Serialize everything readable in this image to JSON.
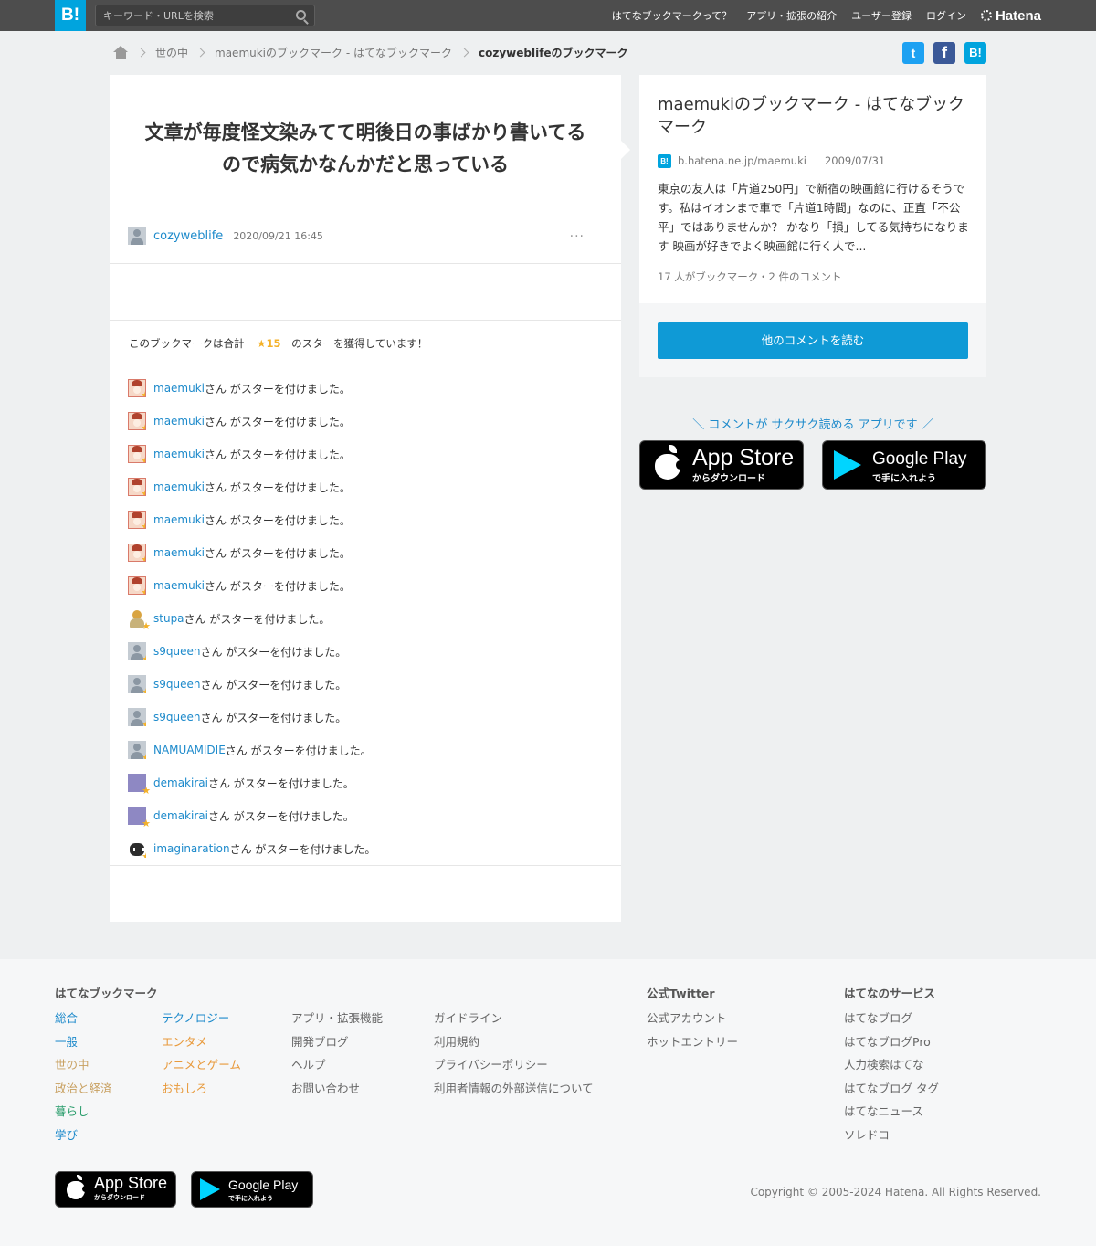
{
  "header": {
    "logo": "B!",
    "search_placeholder": "キーワード・URLを検索",
    "nav": [
      "はてなブックマークって？",
      "アプリ・拡張の紹介",
      "ユーザー登録",
      "ログイン"
    ],
    "brand": "Hatena"
  },
  "breadcrumb": {
    "items": [
      "世の中",
      "maemukiのブックマーク - はてなブックマーク"
    ],
    "current": "cozyweblifeのブックマーク"
  },
  "share": {
    "twitter": "t",
    "facebook": "f",
    "hatena": "B!"
  },
  "comment": {
    "text": "文章が毎度怪文染みてて明後日の事ばかり書いてるので病気かなんかだと思っている",
    "user": "cozyweblife",
    "date": "2020/09/21 16:45",
    "more": "···"
  },
  "stars": {
    "summary_prefix": "このブックマークは合計",
    "count": "★15",
    "summary_suffix": "のスターを獲得しています！",
    "suffix": "さん がスターを付けました。",
    "star_glyph": "★",
    "list": [
      {
        "user": "maemuki",
        "avatar": "maemuki"
      },
      {
        "user": "maemuki",
        "avatar": "maemuki"
      },
      {
        "user": "maemuki",
        "avatar": "maemuki"
      },
      {
        "user": "maemuki",
        "avatar": "maemuki"
      },
      {
        "user": "maemuki",
        "avatar": "maemuki"
      },
      {
        "user": "maemuki",
        "avatar": "maemuki"
      },
      {
        "user": "maemuki",
        "avatar": "maemuki"
      },
      {
        "user": "stupa",
        "avatar": "stupa"
      },
      {
        "user": "s9queen",
        "avatar": "default"
      },
      {
        "user": "s9queen",
        "avatar": "default"
      },
      {
        "user": "s9queen",
        "avatar": "default"
      },
      {
        "user": "NAMUAMIDIE",
        "avatar": "default"
      },
      {
        "user": "demakirai",
        "avatar": "demakirai"
      },
      {
        "user": "demakirai",
        "avatar": "demakirai"
      },
      {
        "user": "imaginaration",
        "avatar": "imagination"
      }
    ]
  },
  "entry": {
    "title": "maemukiのブックマーク - はてなブックマーク",
    "favicon": "B!",
    "domain": "b.hatena.ne.jp/maemuki",
    "date": "2009/07/31",
    "description": "東京の友人は「片道250円」で新宿の映画館に行けるそうです。私はイオンまで車で「片道1時間」なのに、正直「不公平」ではありませんか？ かなり「損」してる気持ちになります 映画が好きでよく映画館に行く人で...",
    "count_text": "17 人がブックマーク・2 件のコメント",
    "read_more": "他のコメントを読む"
  },
  "app_promo": "＼ コメントが サクサク読める アプリです ／",
  "stores": {
    "app_store": {
      "title": "App Store",
      "sub": "からダウンロード"
    },
    "google_play": {
      "title": "Google Play",
      "sub": "で手に入れよう"
    }
  },
  "footer": {
    "col1_title": "はてなブックマーク",
    "categories_a": [
      {
        "label": "総合",
        "color": "#1d8acb"
      },
      {
        "label": "一般",
        "color": "#1d8acb"
      },
      {
        "label": "世の中",
        "color": "#c8a060"
      },
      {
        "label": "政治と経済",
        "color": "#c8a060"
      },
      {
        "label": "暮らし",
        "color": "#2a9d6c"
      },
      {
        "label": "学び",
        "color": "#1d8acb"
      }
    ],
    "categories_b": [
      {
        "label": "テクノロジー",
        "color": "#1d8acb"
      },
      {
        "label": "エンタメ",
        "color": "#e89a3c"
      },
      {
        "label": "アニメとゲーム",
        "color": "#e89a3c"
      },
      {
        "label": "おもしろ",
        "color": "#e89a3c"
      }
    ],
    "links_c": [
      "アプリ・拡張機能",
      "開発ブログ",
      "ヘルプ",
      "お問い合わせ"
    ],
    "links_d": [
      "ガイドライン",
      "利用規約",
      "プライバシーポリシー",
      "利用者情報の外部送信について"
    ],
    "twitter_title": "公式Twitter",
    "twitter_links": [
      "公式アカウント",
      "ホットエントリー"
    ],
    "services_title": "はてなのサービス",
    "services": [
      "はてなブログ",
      "はてなブログPro",
      "人力検索はてな",
      "はてなブログ タグ",
      "はてなニュース",
      "ソレドコ"
    ],
    "copyright": "Copyright © 2005-2024 Hatena. All Rights Reserved."
  }
}
